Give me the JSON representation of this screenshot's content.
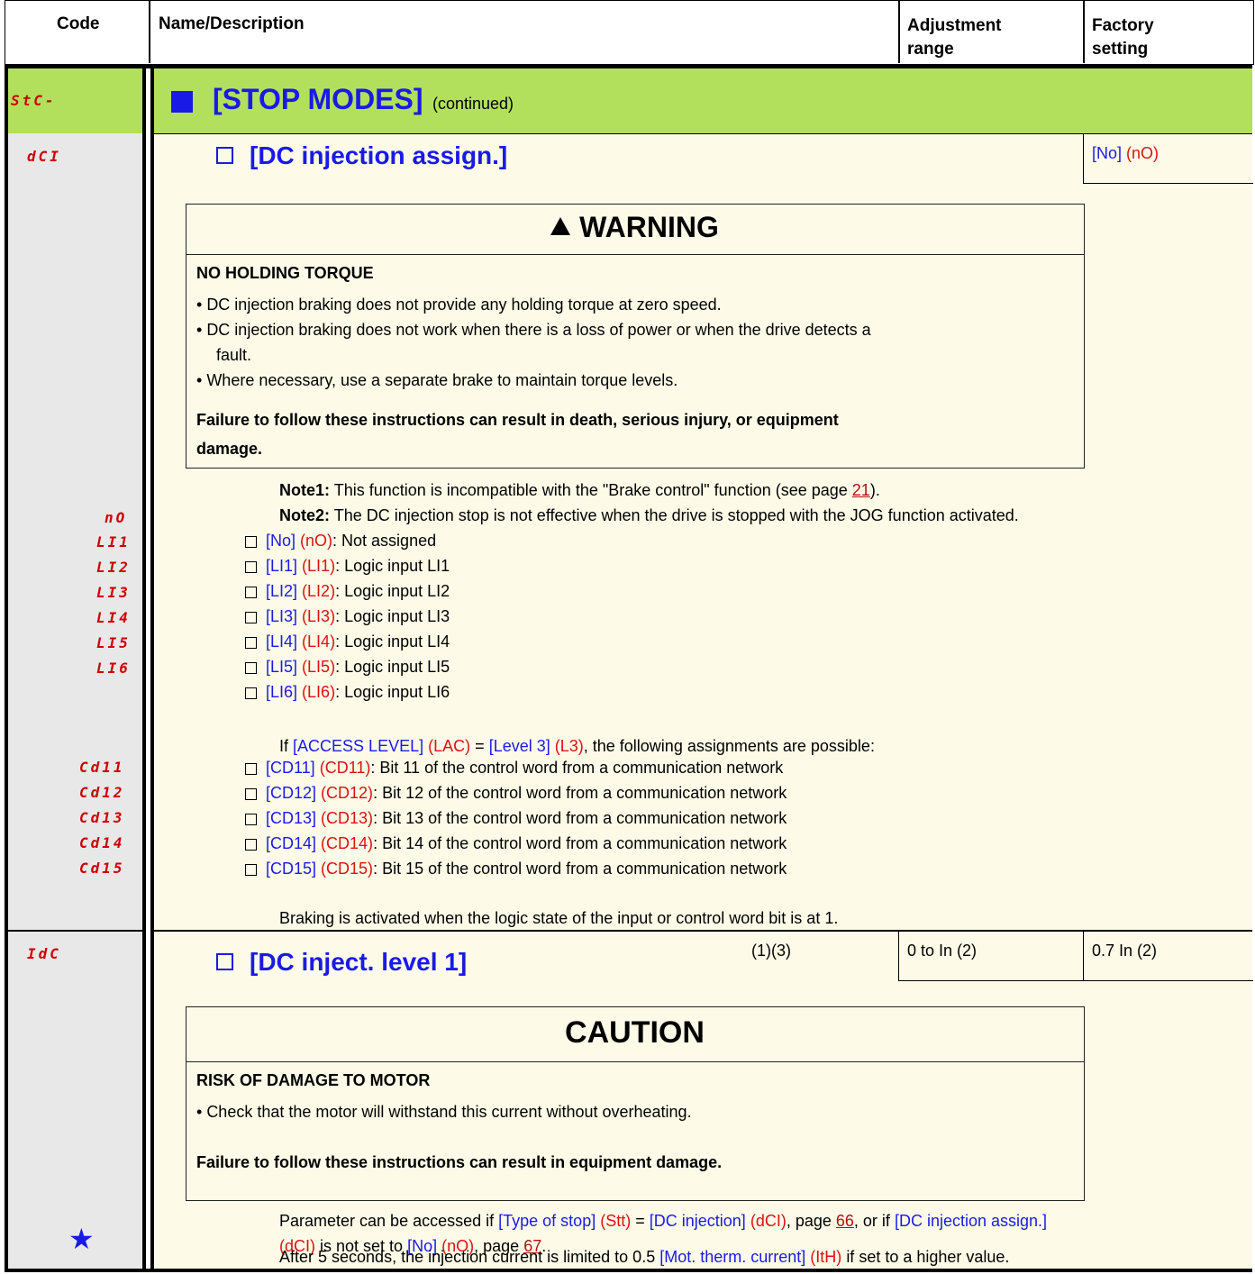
{
  "header": {
    "code": "Code",
    "name": "Name/Description",
    "adjust_line1": "Adjustment",
    "adjust_line2": "range",
    "factory_line1": "Factory",
    "factory_line2": "setting"
  },
  "section": {
    "code": "StC-",
    "title": "[STOP MODES]",
    "continued": "(continued)"
  },
  "param_dci": {
    "code": "dCI",
    "title": "[DC injection assign.]",
    "factory_bracket": "[No]",
    "factory_code": "(nO)"
  },
  "warning": {
    "title": "WARNING",
    "heading": "NO HOLDING TORQUE",
    "bullets": [
      "DC injection braking does not provide any holding torque at zero speed.",
      "DC injection braking does not work when there is a loss of power or when the drive detects a",
      "fault.",
      "Where necessary, use a separate brake to maintain torque levels."
    ],
    "footer_line1": "Failure to follow these instructions can result in death, serious injury, or equipment",
    "footer_line2": "damage."
  },
  "notes": {
    "note1_label": "Note1:",
    "note1_text": "This function is incompatible with the \"Brake control\" function (see page",
    "note1_page": "21",
    "note1_end": ").",
    "note2_label": "Note2:",
    "note2_text": "The DC injection stop is not effective when the drive is stopped with the JOG function activated."
  },
  "options": [
    {
      "code": "nO",
      "bracket": "[No]",
      "paren": "(nO)",
      "desc": ": Not assigned"
    },
    {
      "code": "LI1",
      "bracket": "[LI1]",
      "paren": "(LI1)",
      "desc": ": Logic input LI1"
    },
    {
      "code": "LI2",
      "bracket": "[LI2]",
      "paren": "(LI2)",
      "desc": ": Logic input LI2"
    },
    {
      "code": "LI3",
      "bracket": "[LI3]",
      "paren": "(LI3)",
      "desc": ": Logic input LI3"
    },
    {
      "code": "LI4",
      "bracket": "[LI4]",
      "paren": "(LI4)",
      "desc": ": Logic input LI4"
    },
    {
      "code": "LI5",
      "bracket": "[LI5]",
      "paren": "(LI5)",
      "desc": ": Logic input LI5"
    },
    {
      "code": "LI6",
      "bracket": "[LI6]",
      "paren": "(LI6)",
      "desc": ": Logic input LI6"
    }
  ],
  "access": {
    "prefix": "If",
    "lvl_bracket": "[ACCESS LEVEL]",
    "lvl_code": "(LAC)",
    "eq": "=",
    "lvl3_bracket": "[Level 3]",
    "lvl3_code": "(L3)",
    "suffix": ", the following assignments are possible:"
  },
  "cd_options": [
    {
      "code": "Cd11",
      "bracket": "[CD11]",
      "paren": "(CD11)",
      "desc": ": Bit 11 of the control word from a communication network"
    },
    {
      "code": "Cd12",
      "bracket": "[CD12]",
      "paren": "(CD12)",
      "desc": ": Bit 12 of the control word from a communication network"
    },
    {
      "code": "Cd13",
      "bracket": "[CD13]",
      "paren": "(CD13)",
      "desc": ": Bit 13 of the control word from a communication network"
    },
    {
      "code": "Cd14",
      "bracket": "[CD14]",
      "paren": "(CD14)",
      "desc": ": Bit 14 of the control word from a communication network"
    },
    {
      "code": "Cd15",
      "bracket": "[CD15]",
      "paren": "(CD15)",
      "desc": ": Bit 15 of the control word from a communication network"
    }
  ],
  "braking_note": "Braking is activated when the logic state of the input or control word bit is at 1.",
  "param_idc": {
    "code": "IdC",
    "title": "[DC inject. level 1]",
    "notes_ref": "(1)(3)",
    "range": "0 to In (2)",
    "factory": "0.7 In (2)"
  },
  "caution": {
    "title": "CAUTION",
    "heading": "RISK OF DAMAGE TO MOTOR",
    "bullet": "Check that the motor will withstand this current without overheating.",
    "footer": "Failure to follow these instructions can result in equipment damage."
  },
  "access_note": {
    "t1": "Parameter can be accessed if",
    "b1": "[Type of stop]",
    "c1": "(Stt)",
    "eq": "=",
    "b2": "[DC injection]",
    "c2": "(dCI)",
    "t2": ", page",
    "p1": "66",
    "t3": ", or if",
    "b3": "[DC injection assign.]",
    "c3": "(dCI)",
    "t4": "is not set to",
    "b4": "[No]",
    "c4": "(nO)",
    "t5": ", page",
    "p2": "67",
    "t6": "."
  },
  "limit_note": {
    "t1": "After 5 seconds, the injection current is limited to 0.5",
    "b1": "[Mot. therm. current]",
    "c1": "(ItH)",
    "t2": "if set to a higher value."
  },
  "colors": {
    "section_bar": "#b2e05c",
    "code_column": "#e8e8e8",
    "body_bg": "#fdfbe8",
    "code_red": "#cc0000",
    "bracket_blue": "#1a1ae6"
  }
}
